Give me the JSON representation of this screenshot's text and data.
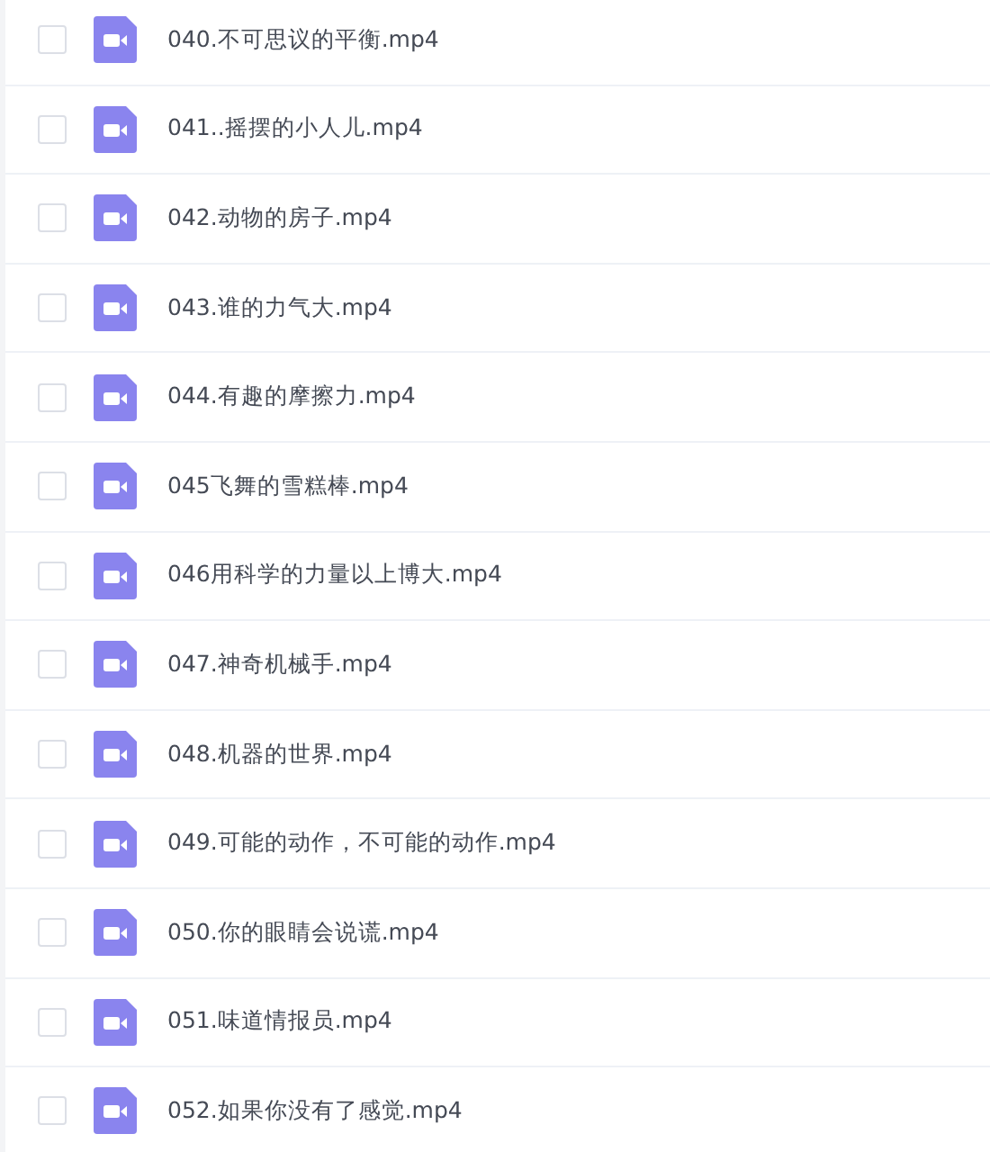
{
  "files": [
    {
      "name": "040.不可思议的平衡.mp4",
      "checked": false
    },
    {
      "name": "041..摇摆的小人儿.mp4",
      "checked": false
    },
    {
      "name": "042.动物的房子.mp4",
      "checked": false
    },
    {
      "name": "043.谁的力气大.mp4",
      "checked": false
    },
    {
      "name": "044.有趣的摩擦力.mp4",
      "checked": false
    },
    {
      "name": "045飞舞的雪糕棒.mp4",
      "checked": false
    },
    {
      "name": "046用科学的力量以上博大.mp4",
      "checked": false
    },
    {
      "name": "047.神奇机械手.mp4",
      "checked": false
    },
    {
      "name": "048.机器的世界.mp4",
      "checked": false
    },
    {
      "name": "049.可能的动作，不可能的动作.mp4",
      "checked": false
    },
    {
      "name": "050.你的眼睛会说谎.mp4",
      "checked": false
    },
    {
      "name": "051.味道情报员.mp4",
      "checked": false
    },
    {
      "name": "052.如果你没有了感觉.mp4",
      "checked": false
    }
  ]
}
